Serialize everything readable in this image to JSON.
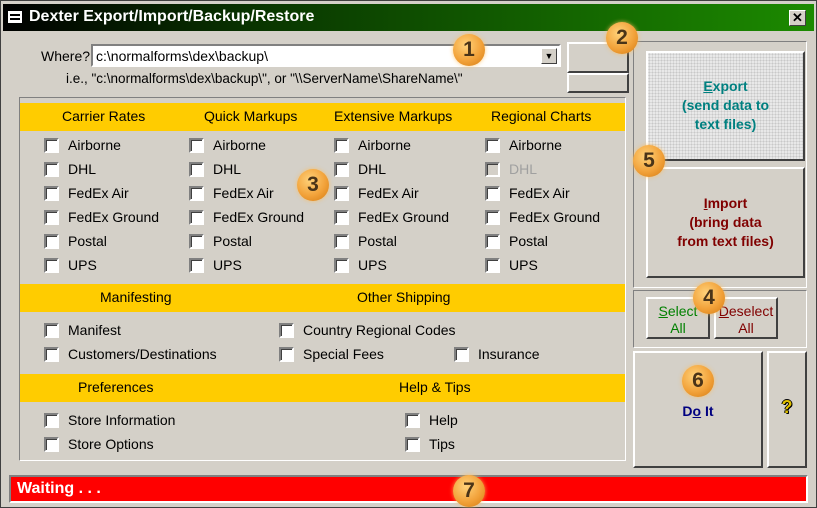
{
  "window": {
    "title": "Dexter Export/Import/Backup/Restore",
    "close_glyph": "✕"
  },
  "path": {
    "label": "Where?",
    "value": "c:\\normalforms\\dex\\backup\\",
    "hint": "i.e., \"c:\\normalforms\\dex\\backup\\\", or \"\\\\ServerName\\ShareName\\\""
  },
  "sections": {
    "carrier_rates": {
      "title": "Carrier Rates",
      "items": [
        "Airborne",
        "DHL",
        "FedEx Air",
        "FedEx Ground",
        "Postal",
        "UPS"
      ]
    },
    "quick_markups": {
      "title": "Quick Markups",
      "items": [
        "Airborne",
        "DHL",
        "FedEx Air",
        "FedEx Ground",
        "Postal",
        "UPS"
      ]
    },
    "extensive_markups": {
      "title": "Extensive Markups",
      "items": [
        "Airborne",
        "DHL",
        "FedEx Air",
        "FedEx Ground",
        "Postal",
        "UPS"
      ]
    },
    "regional_charts": {
      "title": "Regional Charts",
      "items": [
        "Airborne",
        "DHL",
        "FedEx Air",
        "FedEx Ground",
        "Postal",
        "UPS"
      ],
      "disabled": [
        "DHL"
      ]
    },
    "manifesting": {
      "title": "Manifesting",
      "items": [
        "Manifest",
        "Customers/Destinations"
      ]
    },
    "other_shipping": {
      "title": "Other Shipping",
      "items": [
        "Country Regional Codes",
        "Special Fees",
        "Insurance"
      ]
    },
    "preferences": {
      "title": "Preferences",
      "items": [
        "Store Information",
        "Store Options"
      ]
    },
    "help_tips": {
      "title": "Help & Tips",
      "items": [
        "Help",
        "Tips"
      ]
    }
  },
  "buttons": {
    "export": {
      "hotkey": "E",
      "word_rest": "xport",
      "line2": "(send data to",
      "line3": "text files)"
    },
    "import": {
      "hotkey": "I",
      "word_rest": "mport",
      "line2": "(bring data",
      "line3": "from text files)"
    },
    "select_all": {
      "line1_hotkey": "S",
      "line1_rest": "elect",
      "line2": "All"
    },
    "deselect_all": {
      "line1_hotkey": "D",
      "line1_rest": "eselect",
      "line2": "All"
    },
    "do_it": {
      "prefix": "D",
      "hotkey": "o",
      "rest": " It"
    },
    "help_icon": "?"
  },
  "status": {
    "text": "Waiting . . ."
  },
  "callouts": [
    "1",
    "2",
    "3",
    "4",
    "5",
    "6",
    "7"
  ],
  "colors": {
    "title_gradient_start": "#000000",
    "title_gradient_end": "#1c8a00",
    "band": "#ffcc00",
    "status_bg": "#ff0000",
    "export_text": "#008080",
    "import_text": "#800000",
    "select_text": "#008000",
    "deselect_text": "#800000",
    "doit_text": "#000080",
    "callout": "#f2a23a"
  }
}
